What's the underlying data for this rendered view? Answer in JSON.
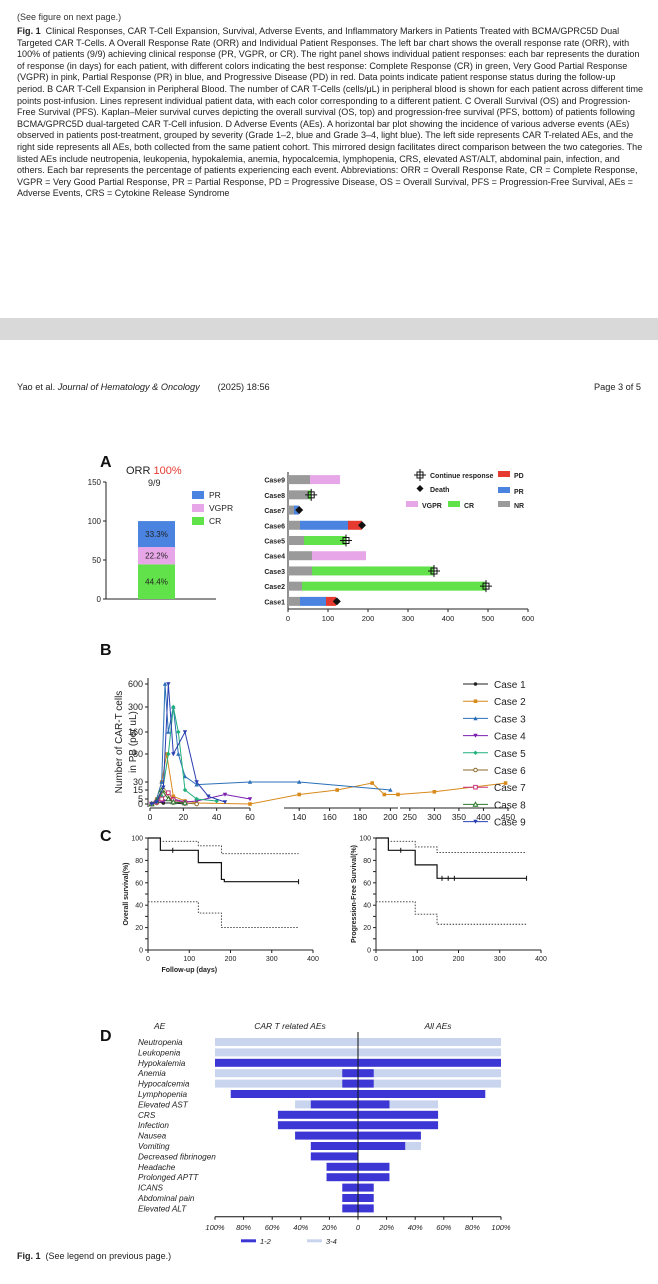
{
  "top": {
    "see_next": "(See figure on next page.)",
    "caption_label": "Fig. 1",
    "caption_body": "Clinical Responses, CAR T-Cell Expansion, Survival, Adverse Events, and Inflammatory Markers in Patients Treated with BCMA/GPRC5D Dual Targeted CAR T-Cells. A Overall Response Rate (ORR) and Individual Patient Responses. The left bar chart shows the overall response rate (ORR), with 100% of patients (9/9) achieving clinical response (PR, VGPR, or CR). The right panel shows individual patient responses: each bar represents the duration of response (in days) for each patient, with different colors indicating the best response: Complete Response (CR) in green, Very Good Partial Response (VGPR) in pink, Partial Response (PR) in blue, and Progressive Disease (PD) in red. Data points indicate patient response status during the follow-up period. B CAR T-Cell Expansion in Peripheral Blood. The number of CAR T-Cells (cells/μL) in peripheral blood is shown for each patient across different time points post-infusion. Lines represent individual patient data, with each color corresponding to a different patient. C Overall Survival (OS) and Progression-Free Survival (PFS). Kaplan–Meier survival curves depicting the overall survival (OS, top) and progression-free survival (PFS, bottom) of patients following BCMA/GPRC5D dual-targeted CAR T-Cell infusion. D Adverse Events (AEs). A horizontal bar plot showing the incidence of various adverse events (AEs) observed in patients post-treatment, grouped by severity (Grade 1–2, blue and Grade 3–4, light blue). The left side represents CAR T-related AEs, and the right side represents all AEs, both collected from the same patient cohort. This mirrored design facilitates direct comparison between the two categories. The listed AEs include neutropenia, leukopenia, hypokalemia, anemia, hypocalcemia, lymphopenia, CRS, elevated AST/ALT, abdominal pain, infection, and others. Each bar represents the percentage of patients experiencing each event. Abbreviations: ORR = Overall Response Rate, CR = Complete Response, VGPR = Very Good Partial Response, PR = Partial Response, PD = Progressive Disease, OS = Overall Survival, PFS = Progression-Free Survival, AEs = Adverse Events, CRS = Cytokine Release Syndrome"
  },
  "header": {
    "authors": "Yao et al.",
    "journal": "Journal of Hematology & Oncology",
    "year_vol": "(2025) 18:56",
    "page": "Page 3 of 5"
  },
  "panels": {
    "a": "A",
    "b": "B",
    "c": "C",
    "d": "D"
  },
  "footer": {
    "label": "Fig. 1",
    "text": "(See legend on previous page.)"
  },
  "colors": {
    "cr": "#62e24a",
    "vgpr": "#e7a6e8",
    "pr": "#4a84e0",
    "pd": "#e53a2f",
    "nr": "#9a9a9a",
    "grade12": "#3c36d4",
    "grade34": "#c9d4ee",
    "orr_red": "#e53a2f"
  },
  "chart_data": [
    {
      "type": "bar",
      "title": "ORR 100%",
      "title_main": "ORR",
      "title_pct": "100%",
      "subtitle": "9/9",
      "ylim": [
        0,
        150
      ],
      "yticks": [
        0,
        50,
        100,
        150
      ],
      "series": [
        {
          "name": "CR",
          "values": [
            44.4
          ],
          "label": "44.4%"
        },
        {
          "name": "VGPR",
          "values": [
            22.2
          ],
          "label": "22.2%"
        },
        {
          "name": "PR",
          "values": [
            33.3
          ],
          "label": "33.3%"
        }
      ],
      "legend": [
        "PR",
        "VGPR",
        "CR"
      ]
    },
    {
      "type": "bar",
      "orientation": "horizontal-stacked",
      "categories": [
        "Case1",
        "Case2",
        "Case3",
        "Case4",
        "Case5",
        "Case6",
        "Case7",
        "Case8",
        "Case9"
      ],
      "xlim": [
        0,
        600
      ],
      "xticks": [
        0,
        100,
        200,
        300,
        400,
        500,
        600
      ],
      "legend": [
        "Continue response",
        "Death",
        "VGPR",
        "CR",
        "PD",
        "PR",
        "NR"
      ],
      "segments": [
        [
          {
            "s": "NR",
            "v": 30
          },
          {
            "s": "PR",
            "v": 65
          },
          {
            "s": "PD",
            "v": 25
          }
        ],
        [
          {
            "s": "NR",
            "v": 35
          },
          {
            "s": "CR",
            "v": 460
          }
        ],
        [
          {
            "s": "NR",
            "v": 60
          },
          {
            "s": "CR",
            "v": 305
          }
        ],
        [
          {
            "s": "NR",
            "v": 60
          },
          {
            "s": "VGPR",
            "v": 135
          }
        ],
        [
          {
            "s": "NR",
            "v": 40
          },
          {
            "s": "CR",
            "v": 105
          }
        ],
        [
          {
            "s": "NR",
            "v": 30
          },
          {
            "s": "PR",
            "v": 120
          },
          {
            "s": "PD",
            "v": 35
          }
        ],
        [
          {
            "s": "NR",
            "v": 15
          },
          {
            "s": "PR",
            "v": 12
          }
        ],
        [
          {
            "s": "NR",
            "v": 50
          },
          {
            "s": "CR",
            "v": 8
          }
        ],
        [
          {
            "s": "NR",
            "v": 55
          },
          {
            "s": "VGPR",
            "v": 75
          }
        ]
      ],
      "markers": [
        {
          "case": "Case1",
          "x": 122,
          "type": "Death"
        },
        {
          "case": "Case2",
          "x": 495,
          "type": "Continue response"
        },
        {
          "case": "Case3",
          "x": 365,
          "type": "Continue response"
        },
        {
          "case": "Case5",
          "x": 145,
          "type": "Continue response"
        },
        {
          "case": "Case6",
          "x": 185,
          "type": "Death"
        },
        {
          "case": "Case7",
          "x": 28,
          "type": "Death"
        },
        {
          "case": "Case8",
          "x": 58,
          "type": "Continue response"
        }
      ]
    },
    {
      "type": "line",
      "xlabel": "Days Since CAR T-Cell Infusion",
      "ylabel": "Number of CAR-T cells in PB (per uL)",
      "ylabel_line1": "Number of CAR-T cells",
      "ylabel_line2": "in PB (per uL)",
      "yticks": [
        "0",
        "5",
        "15",
        "30",
        "80",
        "160",
        "300",
        "600"
      ],
      "xticks": [
        "0",
        "20",
        "40",
        "60",
        "140",
        "160",
        "180",
        "200",
        "250",
        "300",
        "350",
        "400",
        "450"
      ],
      "series": [
        {
          "name": "Case 1",
          "color": "#222222",
          "marker": "circle",
          "points": [
            [
              1,
              0
            ],
            [
              4,
              2
            ],
            [
              8,
              1
            ],
            [
              14,
              1
            ],
            [
              21,
              0
            ]
          ]
        },
        {
          "name": "Case 2",
          "color": "#d88a1c",
          "marker": "square",
          "points": [
            [
              1,
              0
            ],
            [
              4,
              5
            ],
            [
              7,
              30
            ],
            [
              10,
              80
            ],
            [
              14,
              8
            ],
            [
              21,
              3
            ],
            [
              28,
              1
            ],
            [
              60,
              0
            ],
            [
              140,
              10
            ],
            [
              165,
              15
            ],
            [
              188,
              28
            ],
            [
              196,
              10
            ],
            [
              205,
              10
            ],
            [
              300,
              13
            ],
            [
              445,
              28
            ]
          ]
        },
        {
          "name": "Case 3",
          "color": "#2a6fb8",
          "marker": "triangle",
          "points": [
            [
              1,
              0
            ],
            [
              4,
              5
            ],
            [
              7,
              30
            ],
            [
              9,
              600
            ],
            [
              11,
              160
            ],
            [
              14,
              300
            ],
            [
              17,
              80
            ],
            [
              21,
              40
            ],
            [
              28,
              25
            ],
            [
              60,
              30
            ],
            [
              140,
              30
            ],
            [
              200,
              15
            ]
          ]
        },
        {
          "name": "Case 4",
          "color": "#7a1fb0",
          "marker": "triangle-down",
          "points": [
            [
              1,
              0
            ],
            [
              4,
              1
            ],
            [
              8,
              3
            ],
            [
              14,
              5
            ],
            [
              21,
              2
            ],
            [
              28,
              3
            ],
            [
              45,
              10
            ],
            [
              60,
              5
            ]
          ]
        },
        {
          "name": "Case 5",
          "color": "#1fb07a",
          "marker": "diamond",
          "points": [
            [
              1,
              0
            ],
            [
              4,
              2
            ],
            [
              7,
              8
            ],
            [
              11,
              80
            ],
            [
              14,
              300
            ],
            [
              17,
              160
            ],
            [
              21,
              15
            ],
            [
              28,
              5
            ],
            [
              40,
              3
            ]
          ]
        },
        {
          "name": "Case 6",
          "color": "#8a6a2a",
          "marker": "circle-open",
          "points": [
            [
              1,
              0
            ],
            [
              4,
              1
            ],
            [
              8,
              15
            ],
            [
              14,
              2
            ],
            [
              21,
              1
            ],
            [
              28,
              0
            ]
          ]
        },
        {
          "name": "Case 7",
          "color": "#c8357a",
          "marker": "square-open",
          "points": [
            [
              1,
              0
            ],
            [
              4,
              2
            ],
            [
              7,
              5
            ],
            [
              11,
              12
            ],
            [
              14,
              4
            ],
            [
              21,
              1
            ]
          ]
        },
        {
          "name": "Case 8",
          "color": "#2c7a2c",
          "marker": "triangle-open",
          "points": [
            [
              1,
              0
            ],
            [
              4,
              3
            ],
            [
              7,
              15
            ],
            [
              11,
              5
            ],
            [
              14,
              2
            ],
            [
              21,
              1
            ]
          ]
        },
        {
          "name": "Case 9",
          "color": "#2a3fb0",
          "marker": "triangle-down",
          "points": [
            [
              1,
              0
            ],
            [
              4,
              2
            ],
            [
              8,
              20
            ],
            [
              11,
              600
            ],
            [
              14,
              80
            ],
            [
              21,
              160
            ],
            [
              28,
              30
            ],
            [
              35,
              8
            ],
            [
              45,
              2
            ]
          ]
        }
      ]
    },
    {
      "type": "line",
      "subtype": "kaplan-meier",
      "ylabel": "Overall survival(%)",
      "xlabel": "Follow-up (days)",
      "xlim": [
        0,
        400
      ],
      "ylim": [
        0,
        100
      ],
      "xticks": [
        0,
        100,
        200,
        300,
        400
      ],
      "yticks": [
        0,
        10,
        20,
        30,
        40,
        50,
        60,
        70,
        80,
        90,
        100
      ],
      "estimate": [
        [
          0,
          100
        ],
        [
          30,
          100
        ],
        [
          30,
          89
        ],
        [
          122,
          89
        ],
        [
          122,
          78
        ],
        [
          178,
          78
        ],
        [
          178,
          63
        ],
        [
          185,
          63
        ],
        [
          185,
          61
        ],
        [
          365,
          61
        ]
      ],
      "upper": [
        [
          0,
          100
        ],
        [
          30,
          100
        ],
        [
          30,
          97
        ],
        [
          122,
          97
        ],
        [
          122,
          93
        ],
        [
          178,
          93
        ],
        [
          178,
          86
        ],
        [
          365,
          86
        ]
      ],
      "lower": [
        [
          0,
          43
        ],
        [
          122,
          43
        ],
        [
          122,
          33
        ],
        [
          178,
          33
        ],
        [
          178,
          20
        ],
        [
          365,
          20
        ]
      ],
      "censors": [
        [
          60,
          89
        ],
        [
          365,
          61
        ]
      ]
    },
    {
      "type": "line",
      "subtype": "kaplan-meier",
      "ylabel": "Progression-Free Survival(%)",
      "xlabel": "",
      "xlim": [
        0,
        400
      ],
      "ylim": [
        0,
        100
      ],
      "xticks": [
        0,
        100,
        200,
        300,
        400
      ],
      "yticks": [
        0,
        10,
        20,
        30,
        40,
        50,
        60,
        70,
        80,
        90,
        100
      ],
      "estimate": [
        [
          0,
          100
        ],
        [
          30,
          100
        ],
        [
          30,
          89
        ],
        [
          95,
          89
        ],
        [
          95,
          76
        ],
        [
          148,
          76
        ],
        [
          148,
          64
        ],
        [
          365,
          64
        ]
      ],
      "upper": [
        [
          0,
          100
        ],
        [
          30,
          100
        ],
        [
          30,
          97
        ],
        [
          95,
          97
        ],
        [
          95,
          92
        ],
        [
          148,
          92
        ],
        [
          148,
          87
        ],
        [
          365,
          87
        ]
      ],
      "lower": [
        [
          0,
          43
        ],
        [
          95,
          43
        ],
        [
          95,
          32
        ],
        [
          148,
          32
        ],
        [
          148,
          23
        ],
        [
          365,
          23
        ]
      ],
      "censors": [
        [
          60,
          89
        ],
        [
          160,
          64
        ],
        [
          175,
          64
        ],
        [
          190,
          64
        ],
        [
          365,
          64
        ]
      ]
    },
    {
      "type": "bar",
      "orientation": "mirrored-horizontal",
      "header_left": "AE",
      "header_mid": "CAR T  related AEs",
      "header_right": "All AEs",
      "xticks": [
        "100%",
        "80%",
        "60%",
        "40%",
        "20%",
        "0",
        "20%",
        "40%",
        "60%",
        "80%",
        "100%"
      ],
      "series_names": [
        "1-2",
        "3-4"
      ],
      "categories": [
        "Neutropenia",
        "Leukopenia",
        "Hypokalemia",
        "Anemia",
        "Hypocalcemia",
        "Lymphopenia",
        "Elevated AST",
        "CRS",
        "Infection",
        "Nausea",
        "Vomiting",
        "Decreased fibrinogen",
        "Headache",
        "Prolonged APTT",
        "ICANS",
        "Abdominal pain",
        "Elevated ALT"
      ],
      "left_12": [
        0,
        0,
        100,
        11,
        11,
        89,
        33,
        56,
        56,
        44,
        33,
        33,
        22,
        22,
        11,
        11,
        11
      ],
      "left_34": [
        100,
        100,
        0,
        100,
        100,
        0,
        44,
        0,
        0,
        0,
        22,
        0,
        0,
        0,
        0,
        0,
        0
      ],
      "right_12": [
        0,
        0,
        100,
        11,
        11,
        89,
        22,
        56,
        56,
        44,
        33,
        0,
        22,
        22,
        11,
        11,
        11
      ],
      "right_34": [
        100,
        100,
        0,
        100,
        100,
        0,
        56,
        0,
        0,
        0,
        44,
        0,
        0,
        0,
        0,
        0,
        0
      ]
    }
  ]
}
